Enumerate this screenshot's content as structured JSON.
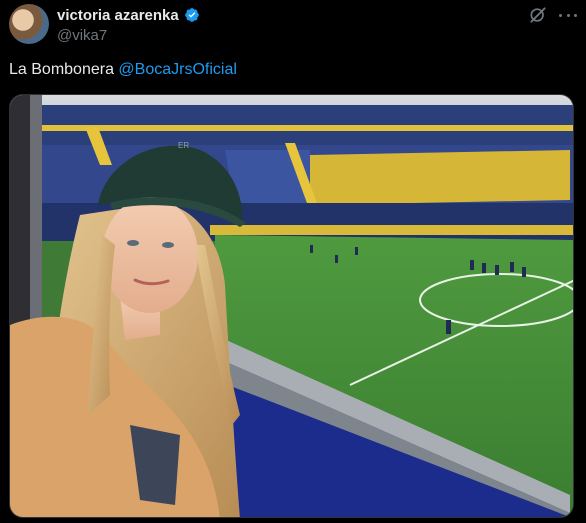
{
  "author": {
    "display_name": "victoria azarenka",
    "handle": "@vika7",
    "verified": true,
    "avatar_icon": "user-avatar"
  },
  "post": {
    "text": "La Bombonera ",
    "mention": "@BocaJrsOficial"
  },
  "icons": {
    "grok": "grok-icon",
    "more": "more-options-icon",
    "verified": "verified-badge-icon"
  },
  "colors": {
    "background": "#000000",
    "text": "#e7e9ea",
    "secondary_text": "#71767b",
    "link": "#1d9bf0",
    "verified": "#1d9bf0"
  },
  "media": {
    "type": "photo",
    "count": 1
  }
}
